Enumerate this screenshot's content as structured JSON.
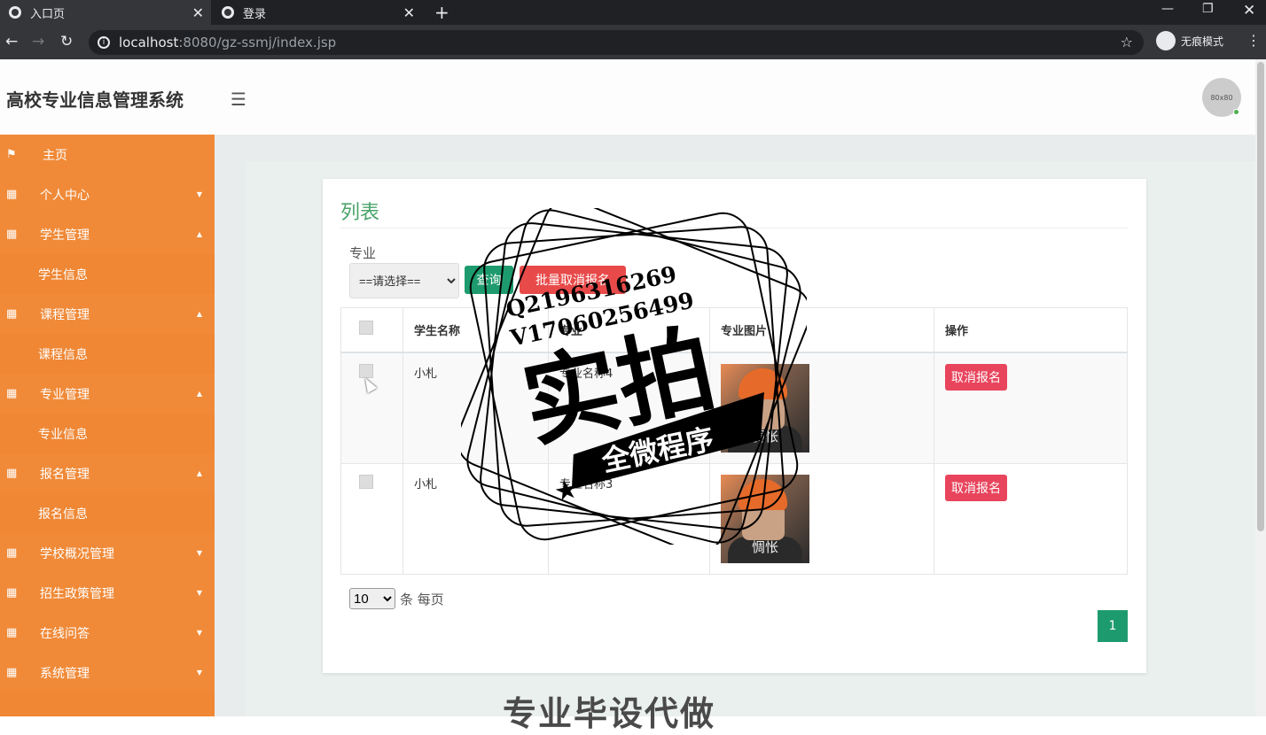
{
  "browser": {
    "tabs": [
      {
        "title": "入口页",
        "active": true
      },
      {
        "title": "登录",
        "active": false
      }
    ],
    "url_host": "localhost",
    "url_rest": ":8080/gz-ssmj/index.jsp",
    "incognito_label": "无痕模式"
  },
  "app": {
    "title": "高校专业信息管理系统",
    "avatar_text": "80x80"
  },
  "sidebar": {
    "items": [
      {
        "label": "主页",
        "icon": "flag-icon",
        "type": "top"
      },
      {
        "label": "个人中心",
        "icon": "grid-icon",
        "type": "parent",
        "caret": "▼"
      },
      {
        "label": "学生管理",
        "icon": "grid-icon",
        "type": "parent",
        "caret": "▲"
      },
      {
        "label": "学生信息",
        "type": "sub"
      },
      {
        "label": "课程管理",
        "icon": "grid-icon",
        "type": "parent",
        "caret": "▲"
      },
      {
        "label": "课程信息",
        "type": "sub"
      },
      {
        "label": "专业管理",
        "icon": "grid-icon",
        "type": "parent",
        "caret": "▲"
      },
      {
        "label": "专业信息",
        "type": "sub"
      },
      {
        "label": "报名管理",
        "icon": "grid-icon",
        "type": "parent",
        "caret": "▲"
      },
      {
        "label": "报名信息",
        "type": "sub"
      },
      {
        "label": "学校概况管理",
        "icon": "grid-icon",
        "type": "parent",
        "caret": "▼"
      },
      {
        "label": "招生政策管理",
        "icon": "grid-icon",
        "type": "parent",
        "caret": "▼"
      },
      {
        "label": "在线问答",
        "icon": "grid-icon",
        "type": "parent",
        "caret": "▼"
      },
      {
        "label": "系统管理",
        "icon": "grid-icon",
        "type": "parent",
        "caret": "▼"
      }
    ]
  },
  "main": {
    "card_title": "列表",
    "filter": {
      "label": "专业",
      "select_value": "==请选择=="
    },
    "buttons": {
      "query": "查询",
      "batch_cancel": "批量取消报名"
    },
    "table": {
      "headers": [
        "",
        "学生名称",
        "专业",
        "专业图片",
        "操作"
      ],
      "rows": [
        {
          "student": "小札",
          "major": "专业名称4",
          "image_caption": "惆怅",
          "action": "取消报名"
        },
        {
          "student": "小札",
          "major": "专业名称3",
          "image_caption": "惆怅",
          "action": "取消报名"
        }
      ]
    },
    "pagination": {
      "page_size": "10",
      "per_page_label": "条 每页",
      "current_page": "1"
    }
  },
  "watermark": {
    "line1": "Q2196316269",
    "line2": "V17060256499",
    "big": "实拍",
    "banner": "全微程序"
  },
  "bottom_text": "专业毕设代做"
}
